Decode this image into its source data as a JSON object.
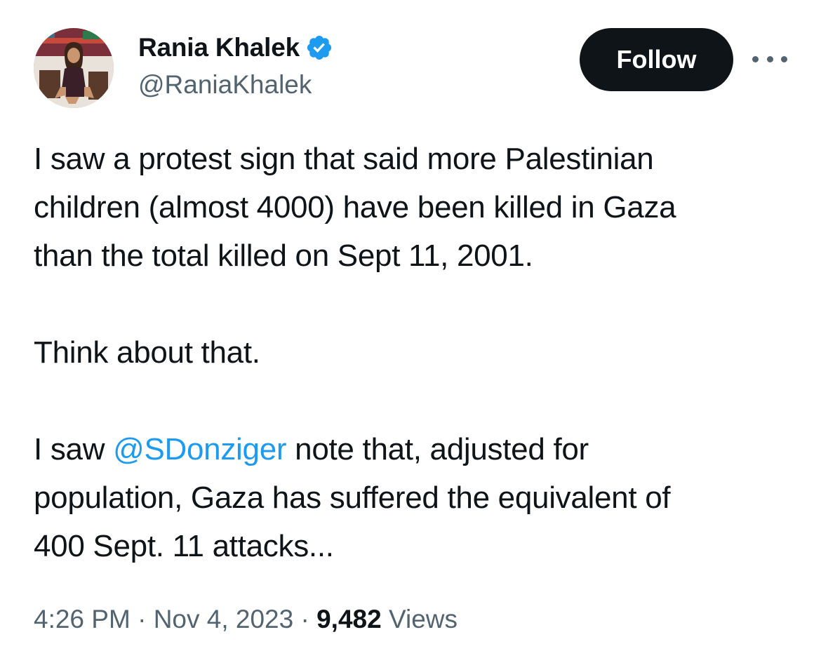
{
  "author": {
    "display_name": "Rania Khalek",
    "handle": "@RaniaKhalek",
    "verified": true,
    "avatar": "profile-photo"
  },
  "actions": {
    "follow_label": "Follow",
    "more_icon": "more-horizontal-icon"
  },
  "tweet": {
    "paragraph_1": {
      "line_1": "I saw a protest sign that said more Palestinian",
      "line_2": "children (almost 4000) have been killed in Gaza",
      "line_3": "than the total killed on Sept 11, 2001."
    },
    "paragraph_2": "Think about that.",
    "paragraph_3": {
      "line_1_prefix": "I saw ",
      "mention": "@SDonziger",
      "line_1_suffix": " note that, adjusted for",
      "line_2": "population, Gaza has suffered the equivalent of",
      "line_3": "400 Sept. 11 attacks..."
    }
  },
  "meta": {
    "time": "4:26 PM",
    "separator": " · ",
    "date": "Nov 4, 2023",
    "views_count": "9,482",
    "views_label": " Views"
  },
  "colors": {
    "text": "#0f1419",
    "secondary": "#536471",
    "accent": "#1d9bf0",
    "follow_bg": "#0f1419"
  }
}
